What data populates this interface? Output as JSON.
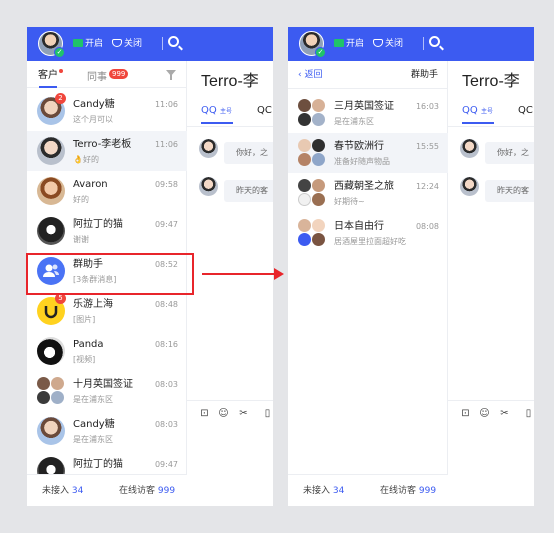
{
  "topbar": {
    "open_label": "开启",
    "close_label": "关闭"
  },
  "left": {
    "tabs": {
      "customers": "客户",
      "colleagues": "同事",
      "colleagues_count": "999"
    },
    "contacts": [
      {
        "name": "Candy糖",
        "message": "这个月可以",
        "time": "11:06",
        "badge": "2"
      },
      {
        "name": "Terro-李老板",
        "message": "👌好的",
        "time": "11:06",
        "badge": ""
      },
      {
        "name": "Avaron",
        "message": "好的",
        "time": "09:58",
        "badge": ""
      },
      {
        "name": "阿拉丁的猫",
        "message": "谢谢",
        "time": "09:47",
        "badge": ""
      },
      {
        "name": "群助手",
        "message": "[3条群消息]",
        "time": "08:52",
        "badge": ""
      },
      {
        "name": "乐游上海",
        "message": "[图片]",
        "time": "08:48",
        "badge": "5"
      },
      {
        "name": "Panda",
        "message": "[视频]",
        "time": "08:16",
        "badge": ""
      },
      {
        "name": "十月英国签证",
        "message": "是在浦东区",
        "time": "08:03",
        "badge": ""
      },
      {
        "name": "Candy糖",
        "message": "是在浦东区",
        "time": "08:03",
        "badge": ""
      },
      {
        "name": "阿拉丁的猫",
        "message": "",
        "time": "09:47",
        "badge": ""
      }
    ],
    "footer": {
      "pending_label": "未接入",
      "pending_value": "34",
      "visitors_label": "在线访客",
      "visitors_value": "999"
    }
  },
  "chat": {
    "title": "Terro-李",
    "tab_qq": "QQ",
    "tab_qq_tag": "主号",
    "tab_qc": "QC",
    "messages": [
      "你好，之",
      "昨天的客"
    ]
  },
  "right": {
    "back_label": "返回",
    "title": "群助手",
    "groups": [
      {
        "name": "三月英国签证",
        "message": "是在浦东区",
        "time": "16:03"
      },
      {
        "name": "春节欧洲行",
        "message": "准备好随声物品",
        "time": "15:55"
      },
      {
        "name": "西藏朝圣之旅",
        "message": "好期待~",
        "time": "12:24"
      },
      {
        "name": "日本自由行",
        "message": "居酒屋里拉面超好吃",
        "time": "08:08"
      }
    ]
  },
  "colors": {
    "brand": "#3c5bf1",
    "badge": "#f0463c",
    "highlight": "#e8252b",
    "online": "#20c36a"
  }
}
